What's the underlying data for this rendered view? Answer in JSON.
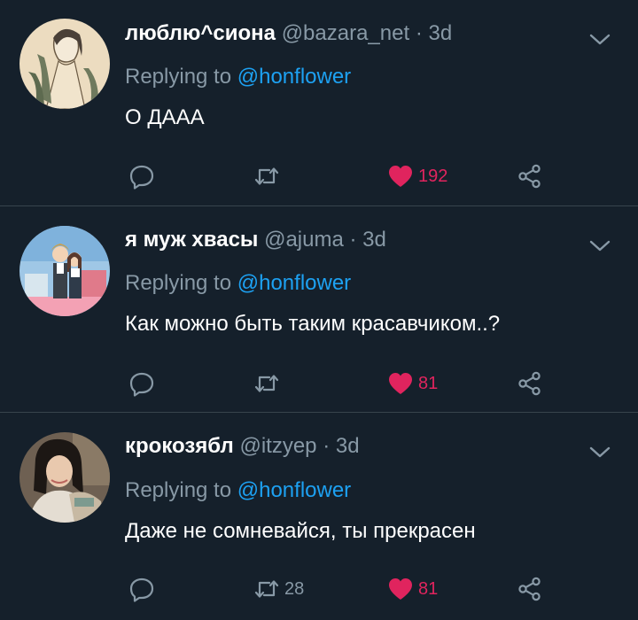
{
  "tweets": [
    {
      "name": "люблю^сиона",
      "handle": "@bazara_net",
      "separator": "·",
      "time": "3d",
      "reply_prefix": "Replying to",
      "reply_to": "@honflower",
      "text": "О ДААА",
      "actions": {
        "reply_count": "",
        "retweet_count": "",
        "like_count": "192",
        "liked": true
      },
      "avatar_icon": "avatar-illustrated-girl-icon"
    },
    {
      "name": "я муж хвасы",
      "handle": "@ajuma",
      "separator": "·",
      "time": "3d",
      "reply_prefix": "Replying to",
      "reply_to": "@honflower",
      "text": "Как можно быть таким красавчиком..?",
      "actions": {
        "reply_count": "",
        "retweet_count": "",
        "like_count": "81",
        "liked": true
      },
      "avatar_icon": "avatar-anime-couple-icon"
    },
    {
      "name": "крокозябл",
      "handle": "@itzyep",
      "separator": "·",
      "time": "3d",
      "reply_prefix": "Replying to",
      "reply_to": "@honflower",
      "text": "Даже не сомневайся, ты прекрасен",
      "actions": {
        "reply_count": "",
        "retweet_count": "28",
        "like_count": "81",
        "liked": true
      },
      "avatar_icon": "avatar-photo-person-icon"
    }
  ],
  "colors": {
    "background": "#15202b",
    "divider": "#38444d",
    "secondary_text": "#8899a6",
    "link": "#1da1f2",
    "like": "#e0245e"
  }
}
